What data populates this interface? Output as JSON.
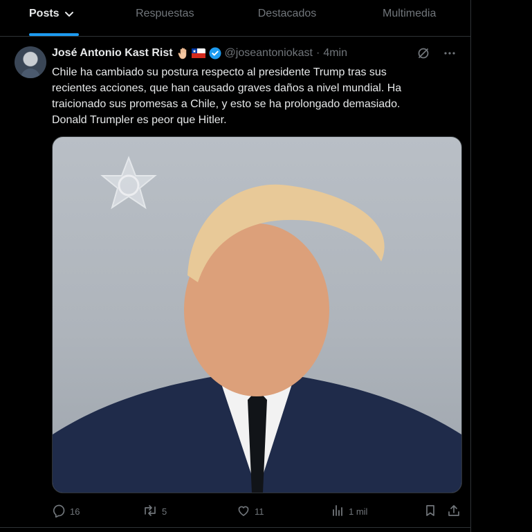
{
  "tabs": [
    {
      "label": "Posts",
      "active": true
    },
    {
      "label": "Respuestas",
      "active": false
    },
    {
      "label": "Destacados",
      "active": false
    },
    {
      "label": "Multimedia",
      "active": false
    }
  ],
  "post": {
    "display_name": "José Antonio Kast Rist",
    "handle": "@joseantoniokast",
    "separator": "·",
    "time": "4min",
    "lines": [
      "Chile ha cambiado su postura respecto al presidente Trump tras sus",
      "recientes acciones, que han causado graves daños a nivel mundial. Ha",
      "traicionado sus promesas a Chile, y esto se ha prolongado demasiado.",
      "Donald Trumpler es peor que Hitler."
    ],
    "media_icon": "photo-media",
    "counts": {
      "replies": "16",
      "reposts": "5",
      "likes": "11",
      "views": "1 mil"
    },
    "icons": {
      "emoji_1": "raised-hand-emoji",
      "emoji_2": "chile-flag-emoji",
      "verified": "verified-badge-icon",
      "grok": "grok-icon",
      "more": "more-icon",
      "reply": "reply-icon",
      "repost": "repost-icon",
      "like": "heart-icon",
      "views": "views-icon",
      "bookmark": "bookmark-icon",
      "share": "share-icon"
    }
  },
  "colors": {
    "background": "#000000",
    "text": "#e7e9ea",
    "muted": "#71767b",
    "accent": "#1d9bf0",
    "border": "#2f3336"
  }
}
